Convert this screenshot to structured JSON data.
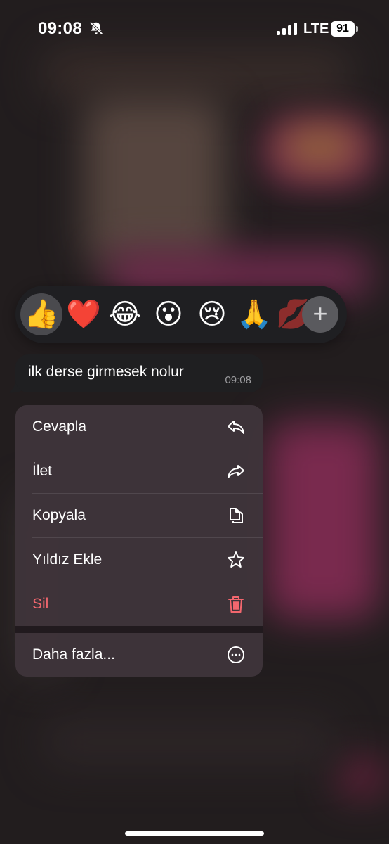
{
  "status_bar": {
    "time": "09:08",
    "network": "LTE",
    "battery": "91"
  },
  "reactions": [
    {
      "emoji": "👍",
      "selected": true
    },
    {
      "emoji": "❤️",
      "selected": false
    },
    {
      "emoji": "😂",
      "selected": false
    },
    {
      "emoji": "😮",
      "selected": false
    },
    {
      "emoji": "😢",
      "selected": false
    },
    {
      "emoji": "🙏",
      "selected": false
    },
    {
      "emoji": "💋",
      "selected": false
    }
  ],
  "message": {
    "text": "ilk derse girmesek nolur",
    "time": "09:08"
  },
  "menu": {
    "reply": "Cevapla",
    "forward": "İlet",
    "copy": "Kopyala",
    "star": "Yıldız Ekle",
    "delete": "Sil",
    "more": "Daha fazla..."
  },
  "colors": {
    "danger": "#f2676e",
    "menu_bg": "#3e343a",
    "bubble_bg": "#1f1f21"
  }
}
